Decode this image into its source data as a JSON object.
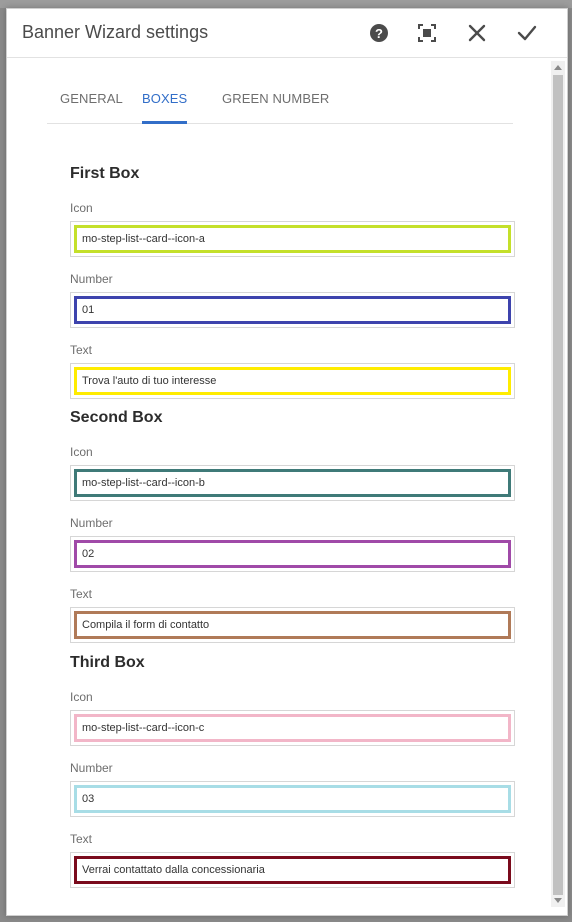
{
  "dialog": {
    "title": "Banner Wizard settings",
    "actions": {
      "help": "help-icon",
      "fullscreen": "fullscreen-icon",
      "close": "close-icon",
      "confirm": "checkmark-icon"
    }
  },
  "tabs": [
    {
      "label": "GENERAL",
      "active": false
    },
    {
      "label": "BOXES",
      "active": true
    },
    {
      "label": "GREEN NUMBER",
      "active": false
    }
  ],
  "sections": [
    {
      "title": "First Box",
      "fields": [
        {
          "label": "Icon",
          "value": "mo-step-list--card--icon-a",
          "color": "#c4e02a"
        },
        {
          "label": "Number",
          "value": "01",
          "color": "#3d43ad"
        },
        {
          "label": "Text",
          "value": "Trova l'auto di tuo interesse",
          "color": "#ffec00"
        }
      ]
    },
    {
      "title": "Second Box",
      "fields": [
        {
          "label": "Icon",
          "value": "mo-step-list--card--icon-b",
          "color": "#3f7a78"
        },
        {
          "label": "Number",
          "value": "02",
          "color": "#a04aa8"
        },
        {
          "label": "Text",
          "value": "Compila il form di contatto",
          "color": "#b07a58"
        }
      ]
    },
    {
      "title": "Third Box",
      "fields": [
        {
          "label": "Icon",
          "value": "mo-step-list--card--icon-c",
          "color": "#f2b6c8"
        },
        {
          "label": "Number",
          "value": "03",
          "color": "#a8dde6"
        },
        {
          "label": "Text",
          "value": "Verrai contattato dalla concessionaria",
          "color": "#7a0a1c"
        }
      ]
    }
  ]
}
